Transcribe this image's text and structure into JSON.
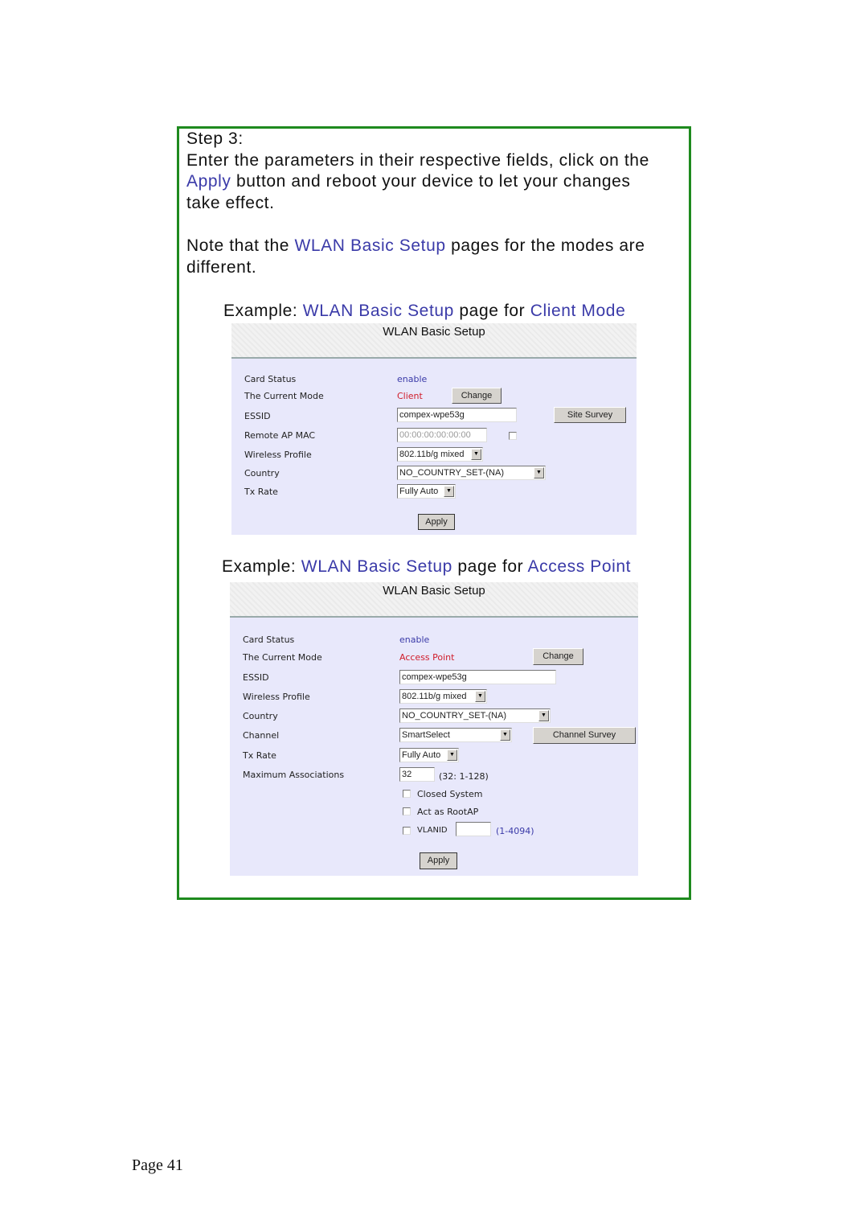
{
  "instructions": {
    "step": "Step 3:",
    "line1": "Enter the parameters in their respective fields, click on the",
    "apply_word": "Apply",
    "line2_rest": " button and reboot your device to let your changes",
    "line3": "take effect.",
    "note_pre": "Note that the ",
    "note_highlight": "WLAN Basic Setup",
    "note_post": " pages for the modes are",
    "note_line2": "different."
  },
  "client_example": {
    "caption_pre": "Example: ",
    "caption_h1": "WLAN Basic Setup",
    "caption_mid": " page for ",
    "caption_h2": "Client Mode",
    "panel_title": "WLAN Basic Setup",
    "labels": {
      "card_status": "Card Status",
      "current_mode": "The Current Mode",
      "essid": "ESSID",
      "remote_ap_mac": "Remote AP MAC",
      "wireless_profile": "Wireless Profile",
      "country": "Country",
      "tx_rate": "Tx Rate"
    },
    "values": {
      "card_status": "enable",
      "current_mode": "Client",
      "essid": "compex-wpe53g",
      "remote_ap_mac": "00:00:00:00:00:00",
      "wireless_profile": "802.11b/g mixed",
      "country": "NO_COUNTRY_SET-(NA)",
      "tx_rate": "Fully Auto"
    },
    "buttons": {
      "change": "Change",
      "site_survey": "Site Survey",
      "apply": "Apply"
    }
  },
  "ap_example": {
    "caption_pre": "Example: ",
    "caption_h1": "WLAN Basic Setup",
    "caption_mid": " page for ",
    "caption_h2": "Access Point",
    "panel_title": "WLAN Basic Setup",
    "labels": {
      "card_status": "Card Status",
      "current_mode": "The Current Mode",
      "essid": "ESSID",
      "wireless_profile": "Wireless Profile",
      "country": "Country",
      "channel": "Channel",
      "tx_rate": "Tx Rate",
      "max_assoc": "Maximum Associations"
    },
    "values": {
      "card_status": "enable",
      "current_mode": "Access Point",
      "essid": "compex-wpe53g",
      "wireless_profile": "802.11b/g mixed",
      "country": "NO_COUNTRY_SET-(NA)",
      "channel": "SmartSelect",
      "tx_rate": "Fully Auto",
      "max_assoc": "32",
      "max_assoc_hint": "(32: 1-128)",
      "vlanid": "",
      "vlanid_hint": "(1-4094)"
    },
    "checkboxes": {
      "closed_system": "Closed System",
      "act_as_rootap": "Act as RootAP",
      "vlanid": "VLANID"
    },
    "buttons": {
      "change": "Change",
      "channel_survey": "Channel Survey",
      "apply": "Apply"
    }
  },
  "footer": {
    "page": "Page 41"
  }
}
